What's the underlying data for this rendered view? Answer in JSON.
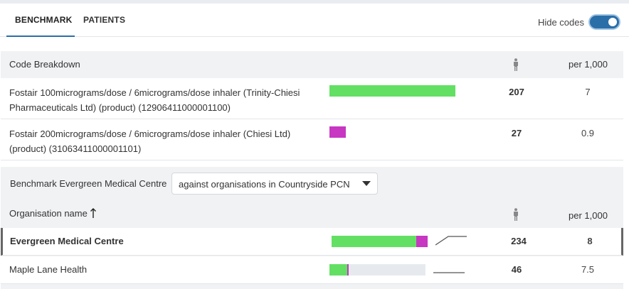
{
  "tabs": [
    {
      "label": "BENCHMARK",
      "active": true
    },
    {
      "label": "PATIENTS",
      "active": false
    }
  ],
  "hide_codes": {
    "label": "Hide codes",
    "on": true
  },
  "codes": {
    "header": {
      "name": "Code Breakdown",
      "count_icon": "person-icon",
      "rate": "per 1,000"
    },
    "rows": [
      {
        "label": "Fostair 100micrograms/dose / 6micrograms/dose inhaler (Trinity-Chiesi Pharmaceuticals Ltd) (product) (12906411000001100)",
        "count": "207",
        "rate": "7",
        "color": "#63e063"
      },
      {
        "label": "Fostair 200micrograms/dose / 6micrograms/dose inhaler (Chiesi Ltd) (product) (31063411000001101)",
        "count": "27",
        "rate": "0.9",
        "color": "#c737c2"
      }
    ]
  },
  "benchmark": {
    "label": "Benchmark Evergreen Medical Centre",
    "select_value": "against organisations in Countryside PCN",
    "org_header": "Organisation name",
    "sort_icon": "sort-ascending-icon",
    "count_icon": "person-icon",
    "rate_header": "per 1,000",
    "orgs": [
      {
        "name": "Evergreen Medical Centre",
        "count": "234",
        "rate": "8",
        "selected": true,
        "segments": [
          {
            "value": 207,
            "color": "#63e063"
          },
          {
            "value": 27,
            "color": "#c737c2"
          }
        ]
      },
      {
        "name": "Maple Lane Health",
        "count": "46",
        "rate": "7.5",
        "selected": false,
        "segments": [
          {
            "value": 44,
            "color": "#63e063"
          },
          {
            "value": 2,
            "color": "#c737c2"
          }
        ]
      }
    ]
  },
  "colors": {
    "accent": "#2a6ea8",
    "green": "#63e063",
    "magenta": "#c737c2"
  }
}
